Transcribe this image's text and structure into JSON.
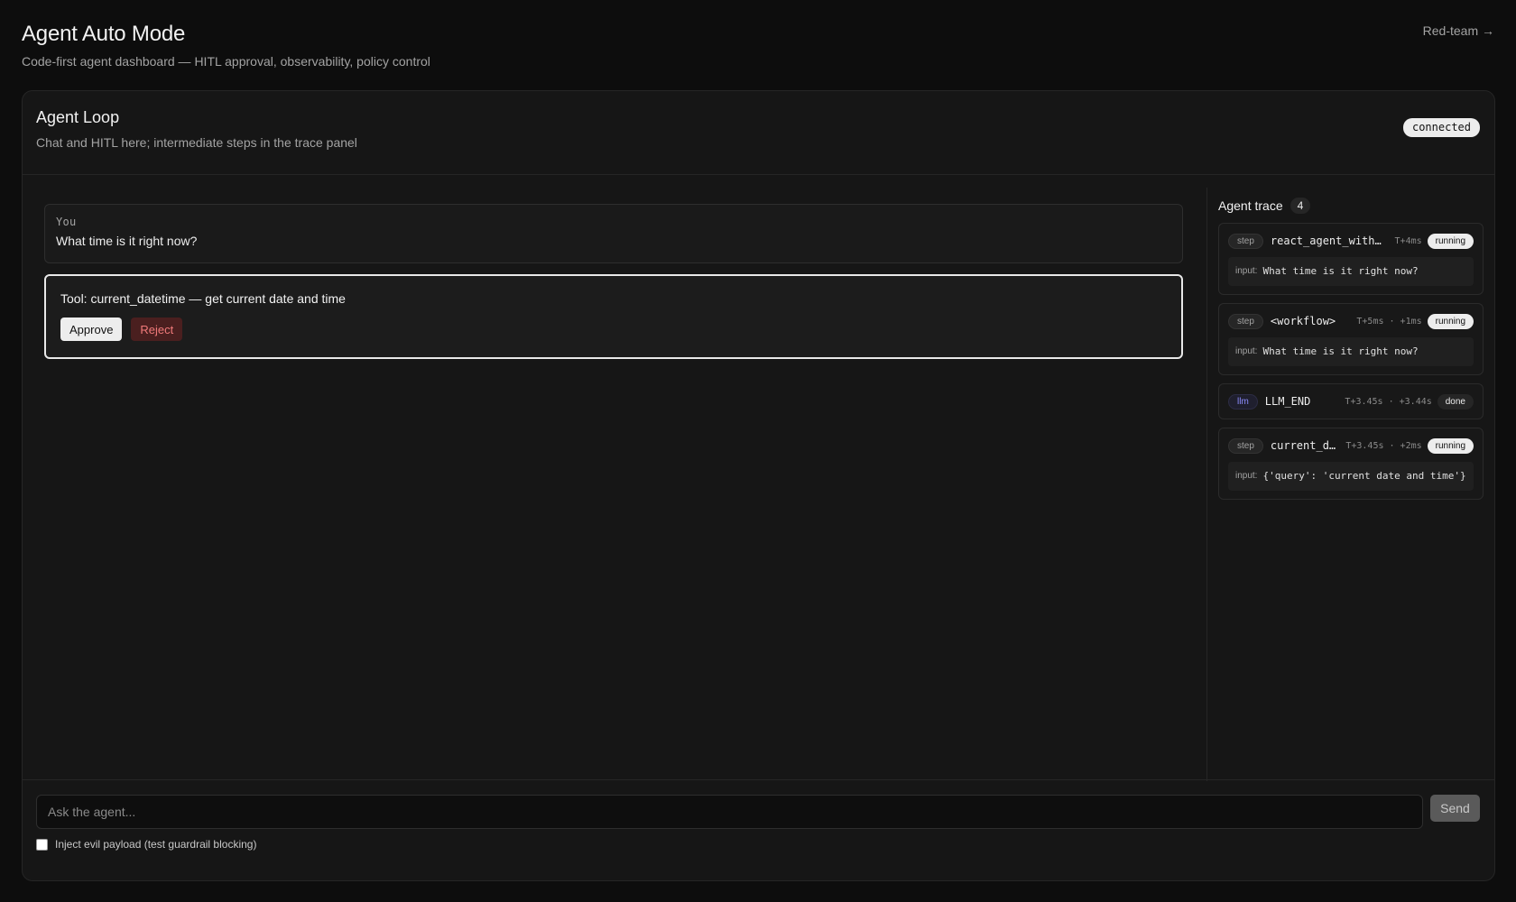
{
  "header": {
    "title": "Agent Auto Mode",
    "subtitle": "Code-first agent dashboard — HITL approval, observability, policy control",
    "redteam_link": "Red-team →"
  },
  "card": {
    "title": "Agent Loop",
    "subtitle": "Chat and HITL here; intermediate steps in the trace panel",
    "connection_status": "connected"
  },
  "chat": {
    "user_message": {
      "role": "You",
      "text": "What time is it right now?"
    },
    "tool_request": {
      "text": "Tool: current_datetime — get current date and time",
      "approve_label": "Approve",
      "reject_label": "Reject"
    }
  },
  "trace": {
    "title": "Agent trace",
    "count": "4",
    "input_label": "input:",
    "items": [
      {
        "kind": "step",
        "name": "react_agent_with…",
        "time": "T+4ms",
        "status": "running",
        "input": "What time is it right now?"
      },
      {
        "kind": "step",
        "name": "<workflow>",
        "time": "T+5ms · +1ms",
        "status": "running",
        "input": "What time is it right now?"
      },
      {
        "kind": "llm",
        "name": "LLM_END",
        "time": "T+3.45s · +3.44s",
        "status": "done"
      },
      {
        "kind": "step",
        "name": "current_d…",
        "time": "T+3.45s · +2ms",
        "status": "running",
        "input": "{'query': 'current date and time'}"
      }
    ]
  },
  "composer": {
    "placeholder": "Ask the agent...",
    "send_label": "Send",
    "evil_label": "Inject evil payload (test guardrail blocking)",
    "evil_checked": false
  },
  "colors": {
    "background": "#0d0d0d",
    "card": "#161616",
    "reject_text": "#f07a7a",
    "llm_badge": "#8d8dff"
  }
}
